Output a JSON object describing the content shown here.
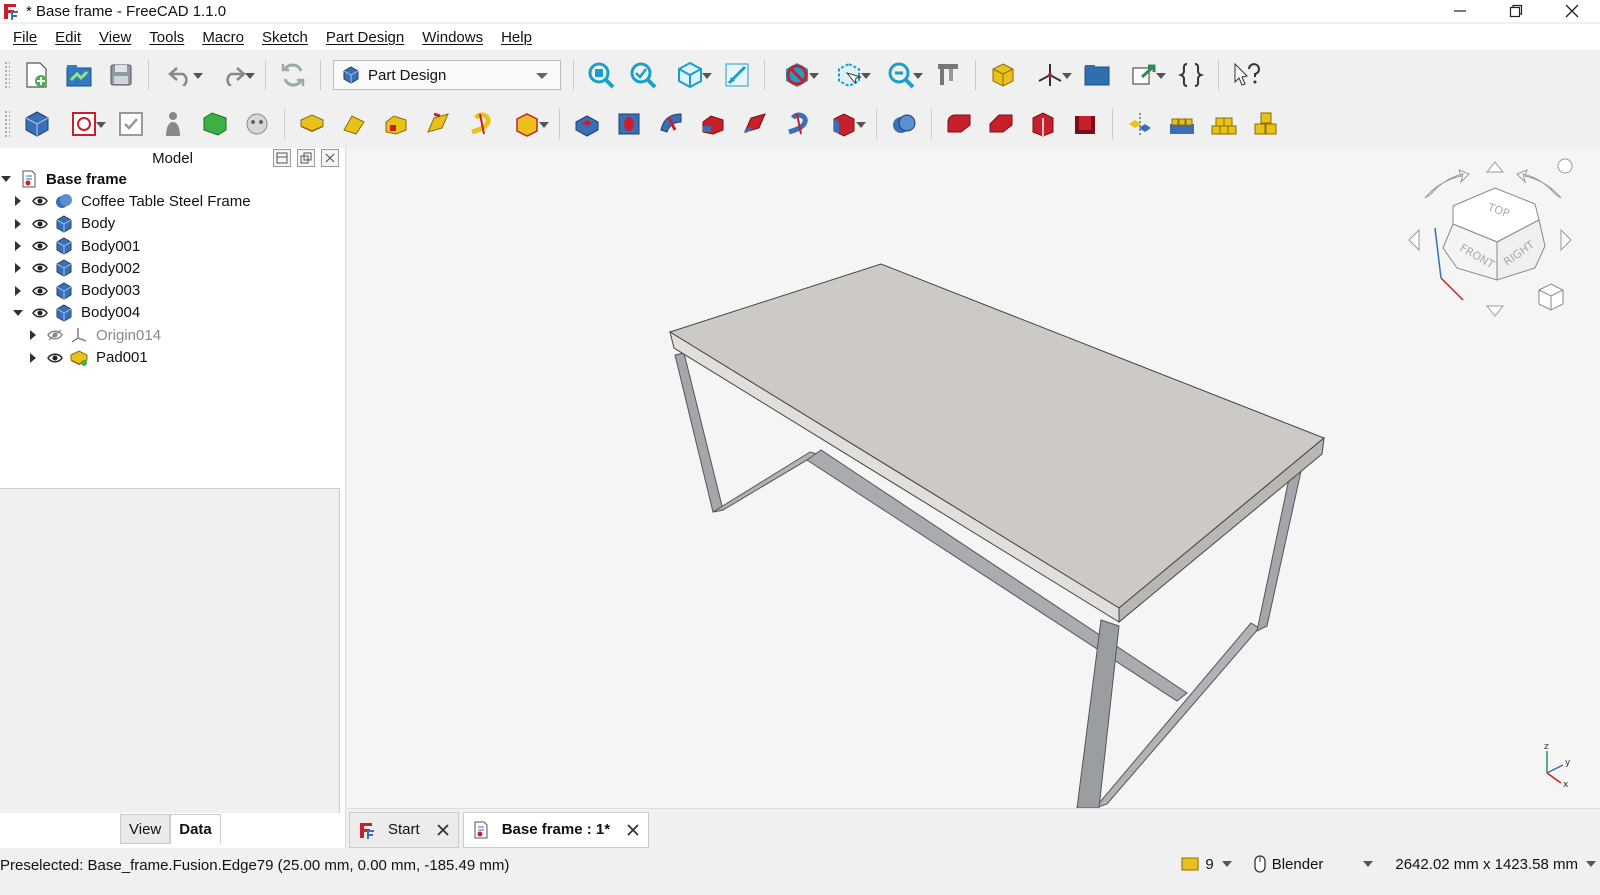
{
  "window": {
    "title": "* Base frame - FreeCAD 1.1.0"
  },
  "menu": [
    "File",
    "Edit",
    "View",
    "Tools",
    "Macro",
    "Sketch",
    "Part Design",
    "Windows",
    "Help"
  ],
  "toolbar": {
    "workbench": "Part Design"
  },
  "model_panel": {
    "title": "Model",
    "tree": {
      "root": "Base frame",
      "items": [
        {
          "label": "Coffee Table Steel Frame"
        },
        {
          "label": "Body"
        },
        {
          "label": "Body001"
        },
        {
          "label": "Body002"
        },
        {
          "label": "Body003"
        },
        {
          "label": "Body004"
        }
      ],
      "children": [
        {
          "label": "Origin014"
        },
        {
          "label": "Pad001"
        }
      ]
    },
    "tabs": [
      "View",
      "Data"
    ]
  },
  "doc_tabs": [
    {
      "label": "Start"
    },
    {
      "label": "Base frame : 1*"
    }
  ],
  "navcube": {
    "top": "TOP",
    "front": "FRONT",
    "right": "RIGHT"
  },
  "axis": {
    "z": "z",
    "y": "y",
    "x": "x"
  },
  "status": {
    "message": "Preselected: Base_frame.Fusion.Edge79 (25.00 mm, 0.00 mm, -185.49 mm)",
    "notifications": "9",
    "nav_style": "Blender",
    "dimensions": "2642.02 mm x 1423.58 mm"
  },
  "colors": {
    "partdesign_blue": "#3a6fb5",
    "pad_yellow": "#e8c21a",
    "pocket_red": "#c8202a",
    "table_top": "#cdc9c4",
    "frame_steel": "#a3a7ab"
  }
}
